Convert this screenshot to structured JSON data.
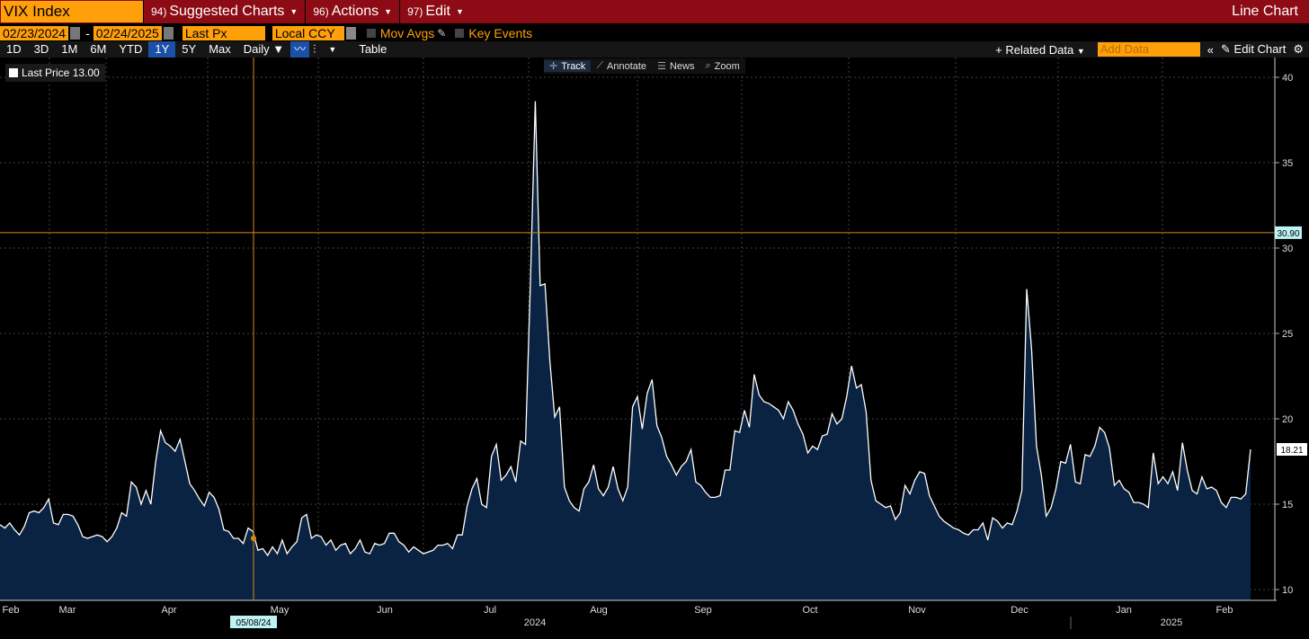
{
  "header": {
    "ticker": "VIX Index",
    "menus": [
      {
        "num": "94)",
        "label": "Suggested Charts"
      },
      {
        "num": "96)",
        "label": "Actions"
      },
      {
        "num": "97)",
        "label": "Edit"
      }
    ],
    "chart_type": "Line Chart"
  },
  "controls": {
    "start_date": "02/23/2024",
    "end_date": "02/24/2025",
    "field": "Last Px",
    "currency": "Local CCY",
    "mov_avgs": "Mov Avgs",
    "key_events": "Key Events"
  },
  "periods": [
    "1D",
    "3D",
    "1M",
    "6M",
    "YTD",
    "1Y",
    "5Y",
    "Max"
  ],
  "active_period": "1Y",
  "frequency": "Daily",
  "table_label": "Table",
  "related_data": "Related Data",
  "add_data_placeholder": "Add Data",
  "edit_chart": "Edit Chart",
  "tools": [
    "Track",
    "Annotate",
    "News",
    "Zoom"
  ],
  "legend": {
    "label": "Last Price",
    "value": "13.00"
  },
  "crosshair": {
    "date_label": "05/08/24",
    "price_label": "30.90",
    "price": 30.9
  },
  "last_label": "18.21",
  "colors": {
    "topbar": "#8c0b14",
    "accent": "#ff9f0a",
    "line": "#ffffff",
    "fill": "#0a2342",
    "crosshair": "#d88a10"
  },
  "chart_data": {
    "type": "area",
    "title": "",
    "xlabel": "",
    "ylabel": "",
    "ylim": [
      9.5,
      41
    ],
    "y_ticks": [
      10,
      15,
      20,
      25,
      30,
      35,
      40
    ],
    "x_months": [
      "Feb",
      "Mar",
      "Apr",
      "May",
      "Jun",
      "Jul",
      "Aug",
      "Sep",
      "Oct",
      "Nov",
      "Dec",
      "Jan",
      "Feb"
    ],
    "x_years": [
      "2024",
      "2025"
    ],
    "series": [
      {
        "values": [
          13.8,
          13.6,
          13.9,
          13.5,
          13.2,
          13.7,
          14.5,
          14.6,
          14.5,
          14.8,
          15.3,
          13.9,
          13.8,
          14.4,
          14.4,
          14.3,
          13.8,
          13.1,
          13.0,
          13.1,
          13.2,
          13.1,
          12.8,
          13.1,
          13.6,
          14.5,
          14.3,
          16.3,
          16.0,
          15.0,
          15.8,
          15.0,
          17.5,
          19.3,
          18.6,
          18.4,
          18.1,
          18.8,
          17.5,
          16.2,
          15.8,
          15.3,
          14.9,
          15.7,
          15.4,
          14.7,
          13.5,
          13.4,
          13.0,
          13.0,
          12.7,
          13.6,
          13.4,
          12.3,
          12.4,
          12.0,
          12.5,
          12.1,
          12.9,
          12.1,
          12.5,
          12.8,
          14.2,
          14.4,
          13.0,
          13.2,
          13.1,
          12.6,
          12.9,
          12.3,
          12.6,
          12.7,
          12.1,
          12.4,
          12.9,
          12.2,
          12.1,
          12.7,
          12.6,
          12.7,
          13.3,
          13.3,
          12.8,
          12.6,
          12.2,
          12.5,
          12.3,
          12.1,
          12.2,
          12.3,
          12.6,
          12.6,
          12.7,
          12.4,
          13.2,
          13.2,
          14.9,
          15.9,
          16.5,
          15.0,
          14.8,
          17.8,
          18.5,
          16.4,
          16.7,
          17.2,
          16.3,
          18.7,
          18.5,
          28.0,
          38.6,
          27.8,
          27.9,
          23.4,
          20.1,
          20.7,
          16.0,
          15.2,
          14.8,
          14.6,
          15.9,
          16.3,
          17.3,
          15.9,
          15.5,
          16.0,
          17.2,
          15.9,
          15.2,
          16.0,
          20.7,
          21.3,
          19.4,
          21.5,
          22.3,
          19.6,
          18.9,
          17.8,
          17.3,
          16.7,
          17.2,
          17.5,
          18.2,
          16.3,
          16.1,
          15.7,
          15.4,
          15.4,
          15.5,
          17.0,
          17.0,
          19.3,
          19.2,
          20.5,
          19.5,
          22.6,
          21.4,
          21.0,
          20.9,
          20.7,
          20.5,
          20.0,
          21.0,
          20.5,
          19.7,
          19.1,
          18.0,
          18.4,
          18.2,
          19.0,
          19.1,
          20.3,
          19.7,
          20.0,
          21.3,
          23.1,
          21.8,
          22.0,
          20.4,
          16.4,
          15.2,
          15.0,
          14.8,
          14.9,
          14.1,
          14.5,
          16.1,
          15.6,
          16.4,
          16.9,
          16.8,
          15.5,
          14.9,
          14.3,
          14.0,
          13.8,
          13.6,
          13.5,
          13.3,
          13.2,
          13.5,
          13.5,
          13.9,
          12.9,
          14.2,
          14.0,
          13.6,
          13.9,
          13.8,
          14.6,
          15.8,
          27.6,
          24.1,
          18.4,
          16.7,
          14.3,
          14.8,
          15.9,
          17.5,
          17.4,
          18.5,
          16.3,
          16.2,
          17.9,
          17.8,
          18.4,
          19.5,
          19.2,
          18.3,
          16.1,
          16.4,
          15.9,
          15.7,
          15.1,
          15.1,
          15.0,
          14.8,
          18.0,
          16.2,
          16.6,
          16.2,
          16.9,
          15.8,
          18.6,
          17.0,
          15.8,
          15.6,
          16.6,
          15.9,
          16.0,
          15.8,
          15.1,
          14.8,
          15.4,
          15.4,
          15.3,
          15.6,
          18.21
        ]
      }
    ]
  }
}
